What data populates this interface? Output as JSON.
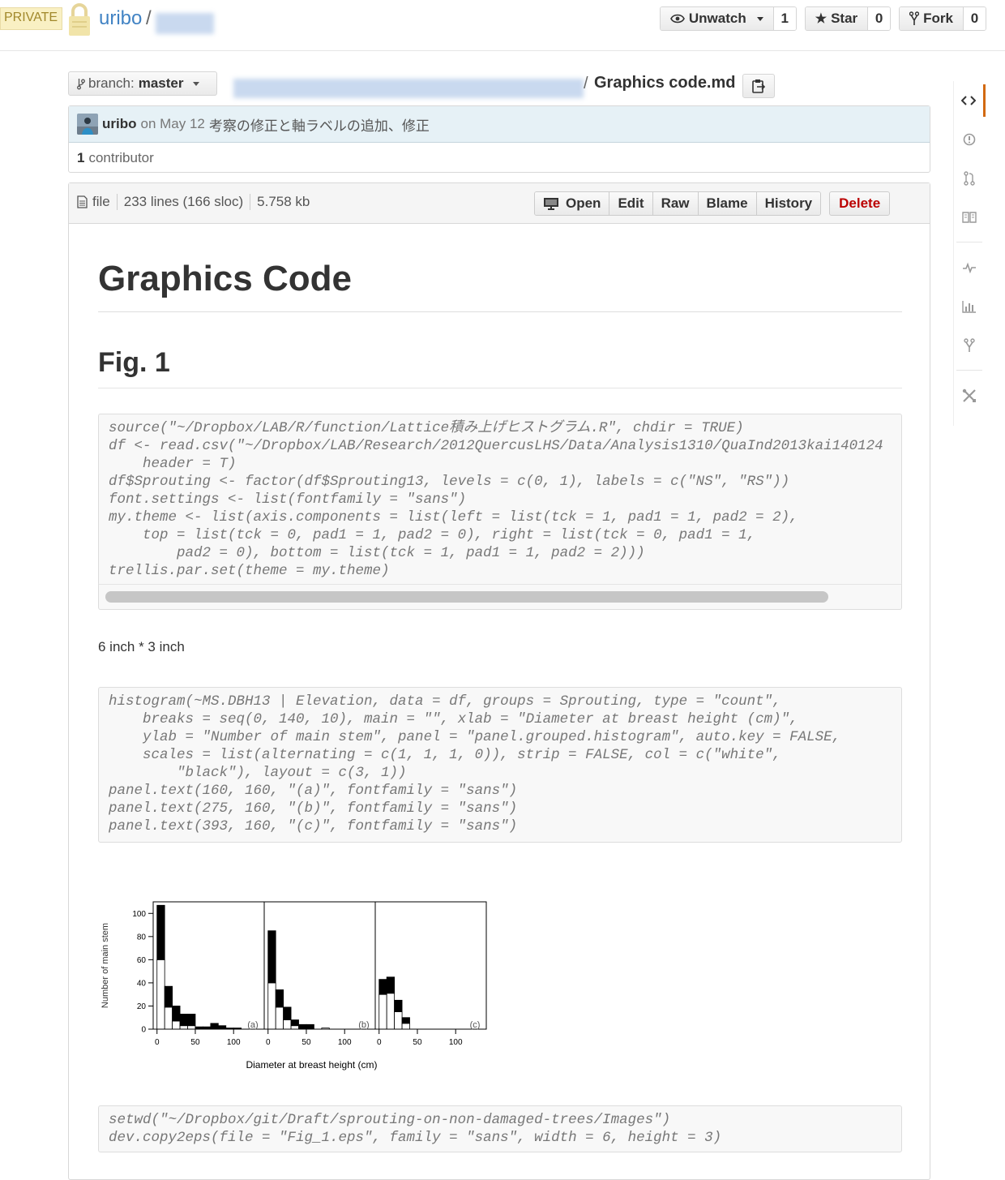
{
  "repo": {
    "private_label": "PRIVATE",
    "owner": "uribo",
    "slash": "/",
    "actions": {
      "watch": {
        "label": "Unwatch",
        "count": "1"
      },
      "star": {
        "label": "Star",
        "count": "0"
      },
      "fork": {
        "label": "Fork",
        "count": "0"
      }
    }
  },
  "breadcrumb": {
    "branch_prefix": "branch:",
    "branch": "master",
    "separator": "/",
    "filename": "Graphics code.md"
  },
  "commit": {
    "author": "uribo",
    "date": "on May 12",
    "message": "考察の修正と軸ラベルの追加、修正",
    "contributors_count": "1",
    "contributors_label": "contributor"
  },
  "file": {
    "type_label": "file",
    "lines": "233 lines (166 sloc)",
    "size": "5.758 kb",
    "actions": {
      "open": "Open",
      "edit": "Edit",
      "raw": "Raw",
      "blame": "Blame",
      "history": "History",
      "delete": "Delete"
    }
  },
  "doc": {
    "title": "Graphics Code",
    "section": "Fig. 1",
    "code1": "source(\"~/Dropbox/LAB/R/function/Lattice積み上げヒストグラム.R\", chdir = TRUE)\ndf <- read.csv(\"~/Dropbox/LAB/Research/2012QuercusLHS/Data/Analysis1310/QuaInd2013kai140124\n    header = T)\ndf$Sprouting <- factor(df$Sprouting13, levels = c(0, 1), labels = c(\"NS\", \"RS\"))\nfont.settings <- list(fontfamily = \"sans\")\nmy.theme <- list(axis.components = list(left = list(tck = 1, pad1 = 1, pad2 = 2),\n    top = list(tck = 0, pad1 = 1, pad2 = 0), right = list(tck = 0, pad1 = 1,\n        pad2 = 0), bottom = list(tck = 1, pad1 = 1, pad2 = 2)))\ntrellis.par.set(theme = my.theme)",
    "size_note": "6 inch * 3 inch",
    "code2": "histogram(~MS.DBH13 | Elevation, data = df, groups = Sprouting, type = \"count\",\n    breaks = seq(0, 140, 10), main = \"\", xlab = \"Diameter at breast height (cm)\",\n    ylab = \"Number of main stem\", panel = \"panel.grouped.histogram\", auto.key = FALSE,\n    scales = list(alternating = c(1, 1, 1, 0)), strip = FALSE, col = c(\"white\",\n        \"black\"), layout = c(3, 1))\npanel.text(160, 160, \"(a)\", fontfamily = \"sans\")\npanel.text(275, 160, \"(b)\", fontfamily = \"sans\")\npanel.text(393, 160, \"(c)\", fontfamily = \"sans\")",
    "code3": "setwd(\"~/Dropbox/git/Draft/sprouting-on-non-damaged-trees/Images\")\ndev.copy2eps(file = \"Fig_1.eps\", family = \"sans\", width = 6, height = 3)"
  },
  "sidebar": {
    "icons": [
      "code-icon",
      "issues-icon",
      "pull-request-icon",
      "wiki-icon",
      "pulse-icon",
      "graphs-icon",
      "network-icon",
      "settings-icon"
    ]
  },
  "colors": {
    "link": "#4183c4",
    "accent": "#d26911",
    "delete": "#bb0000",
    "private_bg": "#f9f0c3"
  },
  "chart_data": {
    "type": "bar",
    "stacked": true,
    "ylabel": "Number of main stem",
    "xlabel": "Diameter at breast height (cm)",
    "ylim": [
      0,
      110
    ],
    "xlim": [
      -5,
      140
    ],
    "y_ticks": [
      "0",
      "20",
      "40",
      "60",
      "80",
      "100"
    ],
    "x_ticks": [
      "0",
      "50",
      "100"
    ],
    "bin_width": 10,
    "panels": [
      {
        "label": "(a)",
        "bins": [
          0,
          10,
          20,
          30,
          40,
          50,
          60,
          70,
          80,
          90,
          100
        ],
        "series": [
          {
            "fill": "white",
            "values": [
              60,
              19,
              7,
              3,
              3,
              0,
              0,
              0,
              0,
              0,
              0
            ]
          },
          {
            "fill": "black",
            "values": [
              47,
              18,
              13,
              10,
              10,
              2,
              2,
              5,
              3,
              1,
              1
            ]
          }
        ]
      },
      {
        "label": "(b)",
        "bins": [
          0,
          10,
          20,
          30,
          40,
          50,
          60,
          70
        ],
        "series": [
          {
            "fill": "white",
            "values": [
              40,
              19,
              8,
              3,
              0,
              0,
              0,
              1
            ]
          },
          {
            "fill": "black",
            "values": [
              45,
              15,
              11,
              5,
              4,
              4,
              0,
              0
            ]
          }
        ]
      },
      {
        "label": "(c)",
        "bins": [
          0,
          10,
          20,
          30
        ],
        "series": [
          {
            "fill": "white",
            "values": [
              30,
              31,
              15,
              5
            ]
          },
          {
            "fill": "black",
            "values": [
              13,
              14,
              10,
              5
            ]
          }
        ]
      }
    ]
  }
}
